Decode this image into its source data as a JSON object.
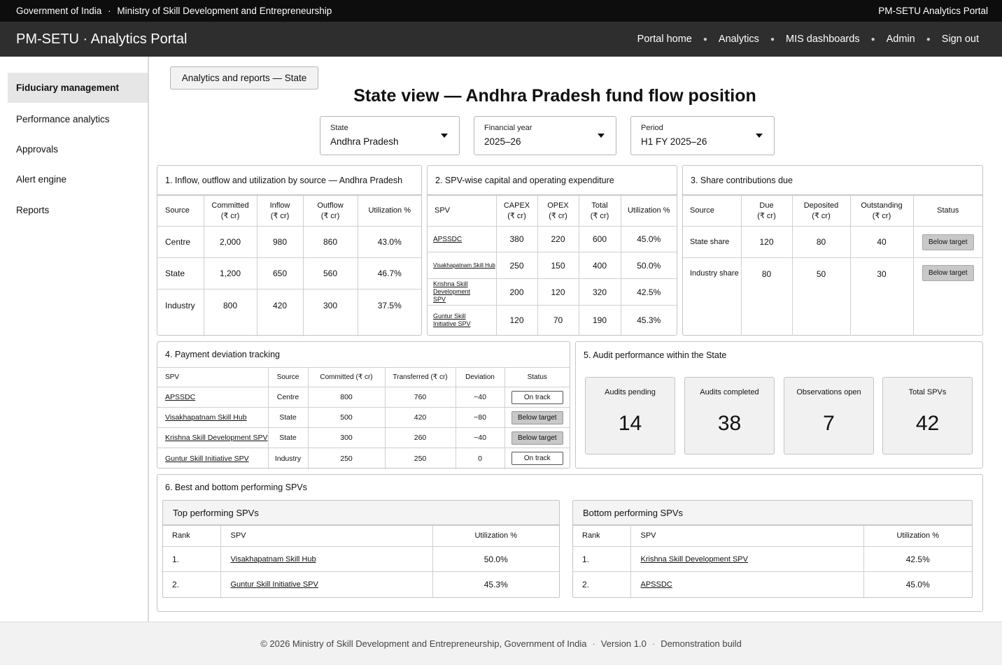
{
  "gov_bar": {
    "left": "Government of India",
    "sep": "·",
    "ministry": "Ministry of Skill Development and Entrepreneurship",
    "right": "PM-SETU Analytics Portal"
  },
  "header": {
    "brand": "PM-SETU · Analytics Portal",
    "nav": [
      "Portal home",
      "Analytics",
      "MIS dashboards",
      "Admin",
      "Sign out"
    ]
  },
  "sidebar": {
    "items": [
      {
        "label": "Fiduciary management"
      },
      {
        "label": "Performance analytics"
      },
      {
        "label": "Approvals"
      },
      {
        "label": "Alert engine"
      },
      {
        "label": "Reports"
      }
    ]
  },
  "breadcrumb": "Analytics and reports — State",
  "page_title": "State view — Andhra Pradesh fund flow position",
  "filters": [
    {
      "label": "State",
      "value": "Andhra Pradesh"
    },
    {
      "label": "Financial year",
      "value": "2025–26"
    },
    {
      "label": "Period",
      "value": "H1 FY 2025–26"
    }
  ],
  "panel1": {
    "title": "1.  Inflow, outflow and utilization by source — Andhra Pradesh",
    "headers": [
      [
        "Source",
        ""
      ],
      [
        "Committed",
        "(₹ cr)"
      ],
      [
        "Inflow",
        "(₹ cr)"
      ],
      [
        "Outflow",
        "(₹ cr)"
      ],
      [
        "Utilization %",
        ""
      ]
    ],
    "rows": [
      [
        "Centre",
        "2,000",
        "980",
        "860",
        "43.0%"
      ],
      [
        "State",
        "1,200",
        "650",
        "560",
        "46.7%"
      ],
      [
        "Industry",
        "800",
        "420",
        "300",
        "37.5%"
      ]
    ]
  },
  "panel2": {
    "title": "2.  SPV-wise capital and operating expenditure",
    "headers": [
      [
        "SPV",
        ""
      ],
      [
        "CAPEX",
        "(₹ cr)"
      ],
      [
        "OPEX",
        "(₹ cr)"
      ],
      [
        "Total",
        "(₹ cr)"
      ],
      [
        "Utilization %",
        ""
      ]
    ],
    "rows": [
      [
        "APSSDC",
        "380",
        "220",
        "600",
        "45.0%"
      ],
      [
        "Visakhapatnam Skill Hub",
        "250",
        "150",
        "400",
        "50.0%"
      ],
      [
        "Krishna Skill Development SPV",
        "200",
        "120",
        "320",
        "42.5%"
      ],
      [
        "Guntur Skill Initiative SPV",
        "120",
        "70",
        "190",
        "45.3%"
      ]
    ]
  },
  "panel3": {
    "title": "3.  Share contributions due",
    "headers": [
      [
        "Source",
        ""
      ],
      [
        "Due",
        "(₹ cr)"
      ],
      [
        "Deposited",
        "(₹ cr)"
      ],
      [
        "Outstanding",
        "(₹ cr)"
      ],
      [
        "Status",
        ""
      ]
    ],
    "rows": [
      [
        "State share",
        "120",
        "80",
        "40",
        "Below target"
      ],
      [
        "Industry share",
        "80",
        "50",
        "30",
        "Below target"
      ]
    ]
  },
  "panel4": {
    "title": "4.  Payment deviation tracking",
    "headers": [
      "SPV",
      "Source",
      "Committed (₹ cr)",
      "Transferred (₹ cr)",
      "Deviation",
      "Status"
    ],
    "rows": [
      [
        "APSSDC",
        "Centre",
        "800",
        "760",
        "−40",
        "On track"
      ],
      [
        "Visakhapatnam Skill Hub",
        "State",
        "500",
        "420",
        "−80",
        "Below target"
      ],
      [
        "Krishna Skill Development SPV",
        "State",
        "300",
        "260",
        "−40",
        "Below target"
      ],
      [
        "Guntur Skill Initiative SPV",
        "Industry",
        "250",
        "250",
        "0",
        "On track"
      ]
    ]
  },
  "panel5": {
    "title": "5.  Audit performance within the State",
    "kpis": [
      {
        "label": "Audits pending",
        "value": "14"
      },
      {
        "label": "Audits completed",
        "value": "38"
      },
      {
        "label": "Observations open",
        "value": "7"
      },
      {
        "label": "Total SPVs",
        "value": "42"
      }
    ]
  },
  "panel6": {
    "title": "6.  Best and bottom performing SPVs",
    "top": {
      "title": "Top performing SPVs",
      "headers": [
        "Rank",
        "SPV",
        "Utilization %"
      ],
      "rows": [
        [
          "1.",
          "Visakhapatnam Skill Hub",
          "50.0%"
        ],
        [
          "2.",
          "Guntur Skill Initiative SPV",
          "45.3%"
        ]
      ]
    },
    "bottom": {
      "title": "Bottom performing SPVs",
      "headers": [
        "Rank",
        "SPV",
        "Utilization %"
      ],
      "rows": [
        [
          "1.",
          "Krishna Skill Development SPV",
          "42.5%"
        ],
        [
          "2.",
          "APSSDC",
          "45.0%"
        ]
      ]
    }
  },
  "footer": {
    "copyright": "© 2026 Ministry of Skill Development and Entrepreneurship, Government of India",
    "version": "Version 1.0",
    "build": "Demonstration build",
    "sep": "·"
  }
}
